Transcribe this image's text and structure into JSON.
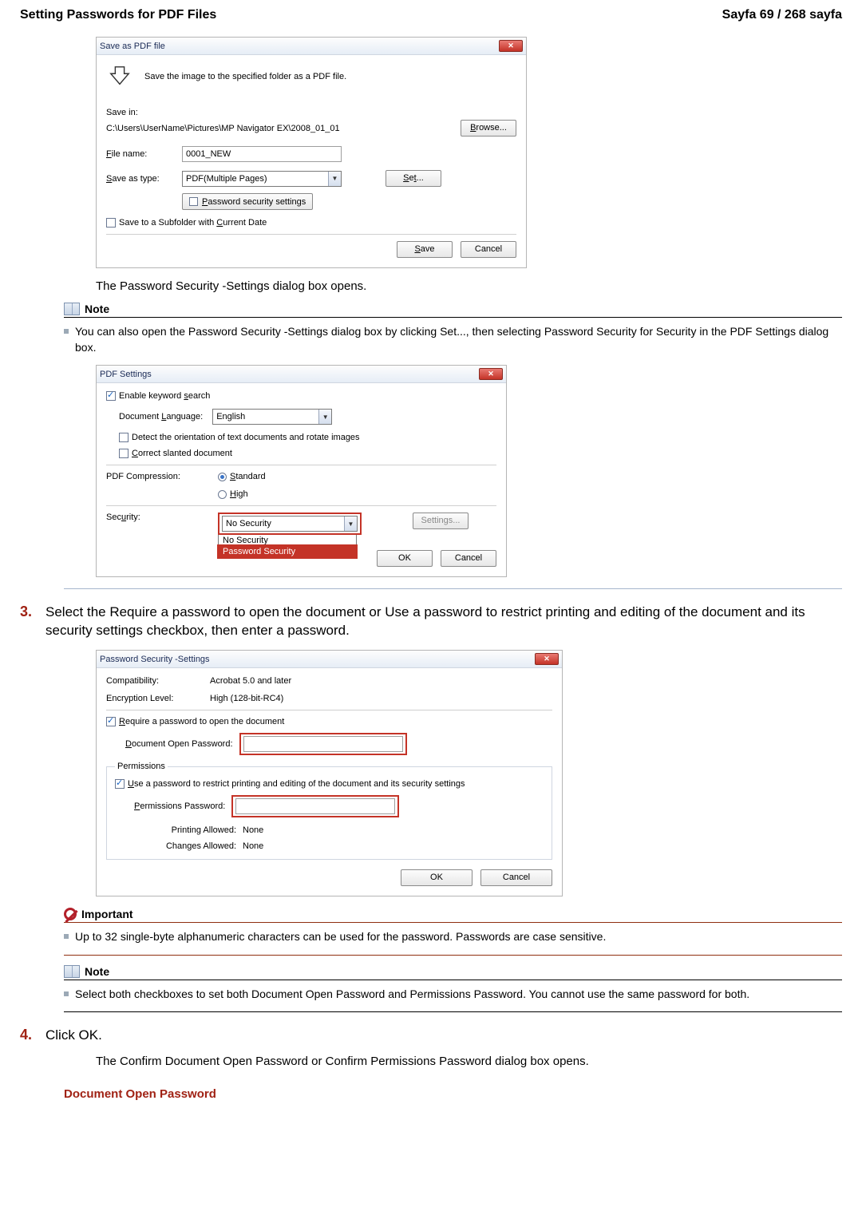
{
  "header": {
    "title": "Setting Passwords for PDF Files",
    "page_indicator": "Sayfa 69 / 268 sayfa"
  },
  "dialog1": {
    "title": "Save as PDF file",
    "intro": "Save the image to the specified folder as a PDF file.",
    "save_in_label": "Save in:",
    "save_in_path": "C:\\Users\\UserName\\Pictures\\MP Navigator EX\\2008_01_01",
    "browse_label": "Browse...",
    "file_name_label": "File name:",
    "file_name_value": "0001_NEW",
    "save_as_type_label": "Save as type:",
    "save_as_type_value": "PDF(Multiple Pages)",
    "set_label": "Set...",
    "pwd_sec_label": "Password security settings",
    "subfolder_label": "Save to a Subfolder with Current Date",
    "save_btn": "Save",
    "cancel_btn": "Cancel"
  },
  "after_dialog1_text": "The Password Security -Settings dialog box opens.",
  "note1": {
    "label": "Note",
    "text": "You can also open the Password Security -Settings dialog box by clicking Set..., then selecting Password Security for Security in the PDF Settings dialog box."
  },
  "dialog2": {
    "title": "PDF Settings",
    "enable_keyword": "Enable keyword search",
    "doc_lang_label": "Document Language:",
    "doc_lang_value": "English",
    "detect_orientation": "Detect the orientation of text documents and rotate images",
    "correct_slanted": "Correct slanted document",
    "compression_label": "PDF Compression:",
    "comp_standard": "Standard",
    "comp_high": "High",
    "security_label": "Security:",
    "security_value": "No Security",
    "settings_btn": "Settings...",
    "opt_nosec": "No Security",
    "opt_pwdsec": "Password Security",
    "ok_btn": "OK",
    "cancel_btn": "Cancel"
  },
  "step3": {
    "num": "3.",
    "text": "Select the Require a password to open the document or Use a password to restrict printing and editing of the document and its security settings checkbox, then enter a password."
  },
  "dialog3": {
    "title": "Password Security -Settings",
    "compat_label": "Compatibility:",
    "compat_value": "Acrobat 5.0 and later",
    "enc_label": "Encryption Level:",
    "enc_value": "High (128-bit-RC4)",
    "require_pwd": "Require a password to open the document",
    "doc_open_pwd_label": "Document Open Password:",
    "permissions_legend": "Permissions",
    "use_pwd_restrict": "Use a password to restrict printing and editing of the document and its security settings",
    "perm_pwd_label": "Permissions Password:",
    "printing_allowed_label": "Printing Allowed:",
    "printing_allowed_value": "None",
    "changes_allowed_label": "Changes Allowed:",
    "changes_allowed_value": "None",
    "ok_btn": "OK",
    "cancel_btn": "Cancel"
  },
  "important": {
    "label": "Important",
    "text": "Up to 32 single-byte alphanumeric characters can be used for the password. Passwords are case sensitive."
  },
  "note2": {
    "label": "Note",
    "text": "Select both checkboxes to set both Document Open Password and Permissions Password. You cannot use the same password for both."
  },
  "step4": {
    "num": "4.",
    "text": "Click OK.",
    "after": "The Confirm Document Open Password or Confirm Permissions Password dialog box opens."
  },
  "subhead": "Document Open Password"
}
